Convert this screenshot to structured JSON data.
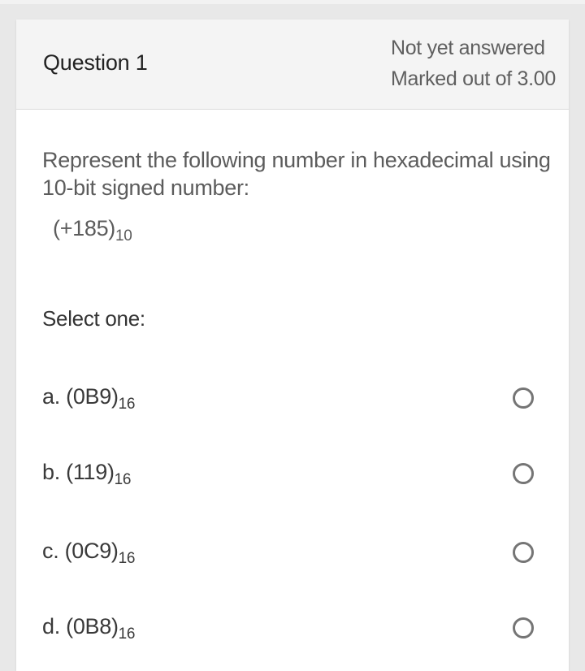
{
  "question": {
    "title": "Question 1",
    "status": "Not yet answered",
    "marks": "Marked out of 3.00",
    "text": "Represent the following number in hexadecimal using 10-bit signed number:",
    "number": {
      "value": "(+185)",
      "base": "10"
    },
    "select_label": "Select one:"
  },
  "options": [
    {
      "letter": "a.",
      "value": "(0B9)",
      "base": "16",
      "selected": false
    },
    {
      "letter": "b.",
      "value": "(119)",
      "base": "16",
      "selected": false
    },
    {
      "letter": "c.",
      "value": "(0C9)",
      "base": "16",
      "selected": false
    },
    {
      "letter": "d.",
      "value": "(0B8)",
      "base": "16",
      "selected": false
    }
  ],
  "colors": {
    "page_background": "#e8e8e8",
    "header_background": "#f4f4f4",
    "card_background": "#ffffff",
    "radio_border": "#757575"
  }
}
